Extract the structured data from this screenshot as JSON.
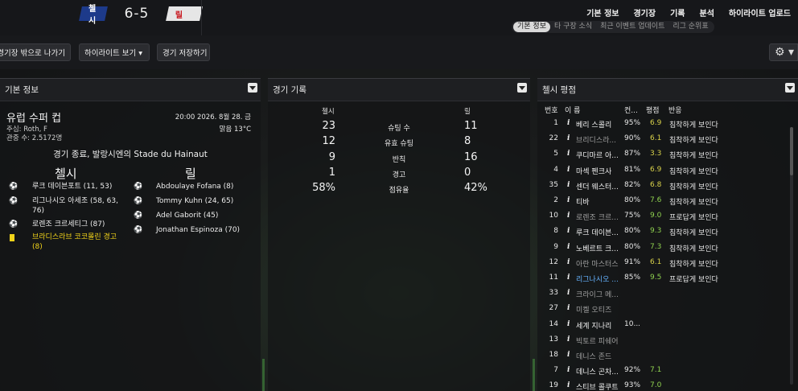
{
  "match": {
    "home_team": "첼시",
    "away_team": "릴",
    "score": "6-5"
  },
  "nav": {
    "main": [
      "기본 정보",
      "경기장",
      "기록",
      "분석",
      "하이라이트 업로드"
    ],
    "sub": [
      "기본 정보",
      "타 구장 소식",
      "최근 이벤트 업데이트",
      "리그 순위표"
    ],
    "active_sub": "기본 정보"
  },
  "toolbar": {
    "leave_label": "경기장 밖으로 나가기",
    "highlights_label": "하이라이트 보기 ▾",
    "save_label": "경기 저장하기",
    "gear": "⚙ ▾"
  },
  "info_panel": {
    "title": "기본 정보",
    "competition": "유럽 수퍼 컵",
    "datetime": "20:00 2026. 8월 28. 금",
    "referee": "주심: Roth, F",
    "weather": "맑음 13°C",
    "attendance": "관중 수: 2.5172명",
    "result_text": "경기 종료, 발랑시엔의 Stade du Hainaut",
    "home_name": "첼시",
    "away_name": "릴",
    "home_events": [
      {
        "text": "루크 데이븐포트 (11, 53)",
        "type": "goal"
      },
      {
        "text": "리그나시오 아세조 (58, 63, 76)",
        "type": "goal"
      },
      {
        "text": "로렌조 크르세티그 (87)",
        "type": "goal"
      },
      {
        "text": "브라디스라브 코코몰린 경고 (8)",
        "type": "yellow"
      }
    ],
    "away_events": [
      {
        "text": "Abdoulaye Fofana (8)",
        "type": "goal"
      },
      {
        "text": "Tommy Kuhn (24, 65)",
        "type": "goal"
      },
      {
        "text": "Adel Gaborit (45)",
        "type": "goal"
      },
      {
        "text": "Jonathan Espinoza (70)",
        "type": "goal"
      }
    ]
  },
  "stats_panel": {
    "title": "경기 기록",
    "home_label": "첼시",
    "away_label": "릴",
    "rows": [
      {
        "label": "슈팅 수",
        "home": "23",
        "away": "11"
      },
      {
        "label": "유효 슈팅",
        "home": "12",
        "away": "8"
      },
      {
        "label": "반칙",
        "home": "9",
        "away": "16"
      },
      {
        "label": "경고",
        "home": "1",
        "away": "0"
      },
      {
        "label": "점유율",
        "home": "58%",
        "away": "42%"
      }
    ]
  },
  "ratings_panel": {
    "title": "첼시 평점",
    "headers": {
      "num": "번호",
      "name": "이 름",
      "cond": "컨...",
      "rating": "평점",
      "reaction": "반응"
    },
    "info_icon": "i",
    "rows": [
      {
        "num": "1",
        "name": "베리 스콜리",
        "cond": "95%",
        "rating": "6.9",
        "reaction": "침착하게 보인다",
        "style": "normal"
      },
      {
        "num": "22",
        "name": "브리디스라...",
        "cond": "90%",
        "rating": "6.1",
        "reaction": "침착하게 보인다",
        "style": "dim"
      },
      {
        "num": "5",
        "name": "쿠디마르 아...",
        "cond": "87%",
        "rating": "3.3",
        "reaction": "침착하게 보인다",
        "style": "normal"
      },
      {
        "num": "4",
        "name": "마섹 펜크사",
        "cond": "81%",
        "rating": "6.9",
        "reaction": "침착하게 보인다",
        "style": "normal"
      },
      {
        "num": "35",
        "name": "센더 웨스터...",
        "cond": "82%",
        "rating": "6.8",
        "reaction": "침착하게 보인다",
        "style": "normal"
      },
      {
        "num": "2",
        "name": "티바",
        "cond": "80%",
        "rating": "7.6",
        "reaction": "침착하게 보인다",
        "style": "normal"
      },
      {
        "num": "10",
        "name": "로렌조 크르...",
        "cond": "75%",
        "rating": "9.0",
        "reaction": "프로답게 보인다",
        "style": "dim"
      },
      {
        "num": "8",
        "name": "루크 데이븐...",
        "cond": "80%",
        "rating": "9.3",
        "reaction": "침착하게 보인다",
        "style": "normal"
      },
      {
        "num": "9",
        "name": "노베르트 크...",
        "cond": "80%",
        "rating": "7.3",
        "reaction": "침착하게 보인다",
        "style": "normal"
      },
      {
        "num": "12",
        "name": "아란 마스터스",
        "cond": "91%",
        "rating": "6.1",
        "reaction": "침착하게 보인다",
        "style": "dim"
      },
      {
        "num": "11",
        "name": "리그나시오 ...",
        "cond": "85%",
        "rating": "9.5",
        "reaction": "프로답게 보인다",
        "style": "blue"
      },
      {
        "num": "33",
        "name": "크라이그 메...",
        "cond": "",
        "rating": "",
        "reaction": "",
        "style": "dim"
      },
      {
        "num": "27",
        "name": "미켈 오티즈",
        "cond": "",
        "rating": "",
        "reaction": "",
        "style": "dim"
      },
      {
        "num": "14",
        "name": "세계 지나리",
        "cond": "10...",
        "rating": "",
        "reaction": "",
        "style": "normal"
      },
      {
        "num": "13",
        "name": "빅토르 피쉐어",
        "cond": "",
        "rating": "",
        "reaction": "",
        "style": "dim"
      },
      {
        "num": "18",
        "name": "데니스 존드",
        "cond": "",
        "rating": "",
        "reaction": "",
        "style": "dim"
      },
      {
        "num": "7",
        "name": "데니스 곤차...",
        "cond": "92%",
        "rating": "7.1",
        "reaction": "",
        "style": "normal"
      },
      {
        "num": "19",
        "name": "스티브 콜쿠트",
        "cond": "93%",
        "rating": "7.0",
        "reaction": "",
        "style": "normal"
      }
    ]
  },
  "colors": {
    "rating_green": "#8fd14f",
    "rating_yellow": "#d9d24a",
    "home_badge": "#1d3a8a",
    "yellow_card": "#f1d31a",
    "dim_name": "#9e9e9e",
    "blue_name": "#66b3ff"
  }
}
